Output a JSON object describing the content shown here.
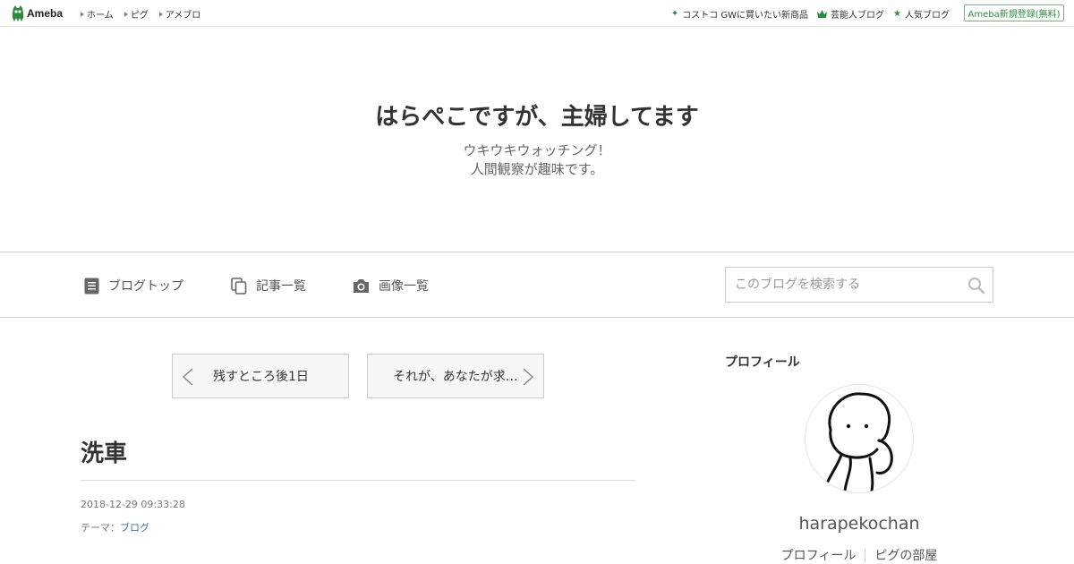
{
  "topbar": {
    "logo": "Ameba",
    "nav": [
      "ホーム",
      "ピグ",
      "アメブロ"
    ],
    "right_links": [
      {
        "icon": "sparkle-icon",
        "label": "コストコ GWに買いたい新商品"
      },
      {
        "icon": "crown-icon",
        "label": "芸能人ブログ"
      },
      {
        "icon": "star-icon",
        "label": "人気ブログ"
      }
    ],
    "register": "Ameba新規登録(無料)"
  },
  "header": {
    "title": "はらぺこですが、主婦してます",
    "description_line1": "ウキウキウォッチング！",
    "description_line2": "人間観察が趣味です。"
  },
  "blognav": {
    "items": [
      {
        "icon": "document-icon",
        "label": "ブログトップ"
      },
      {
        "icon": "copy-icon",
        "label": "記事一覧"
      },
      {
        "icon": "camera-icon",
        "label": "画像一覧"
      }
    ],
    "search_placeholder": "このブログを検索する"
  },
  "pager": {
    "prev": "残すところ後1日",
    "next": "それが、あなたが求…"
  },
  "entry": {
    "title": "洗車",
    "date": "2018-12-29 09:33:28",
    "theme_label": "テーマ：",
    "theme": "ブログ"
  },
  "profile": {
    "heading": "プロフィール",
    "name": "harapekochan",
    "links": [
      "プロフィール",
      "ピグの部屋"
    ]
  },
  "colors": {
    "brand": "#2d8c3c",
    "link": "#3a6fb0"
  }
}
